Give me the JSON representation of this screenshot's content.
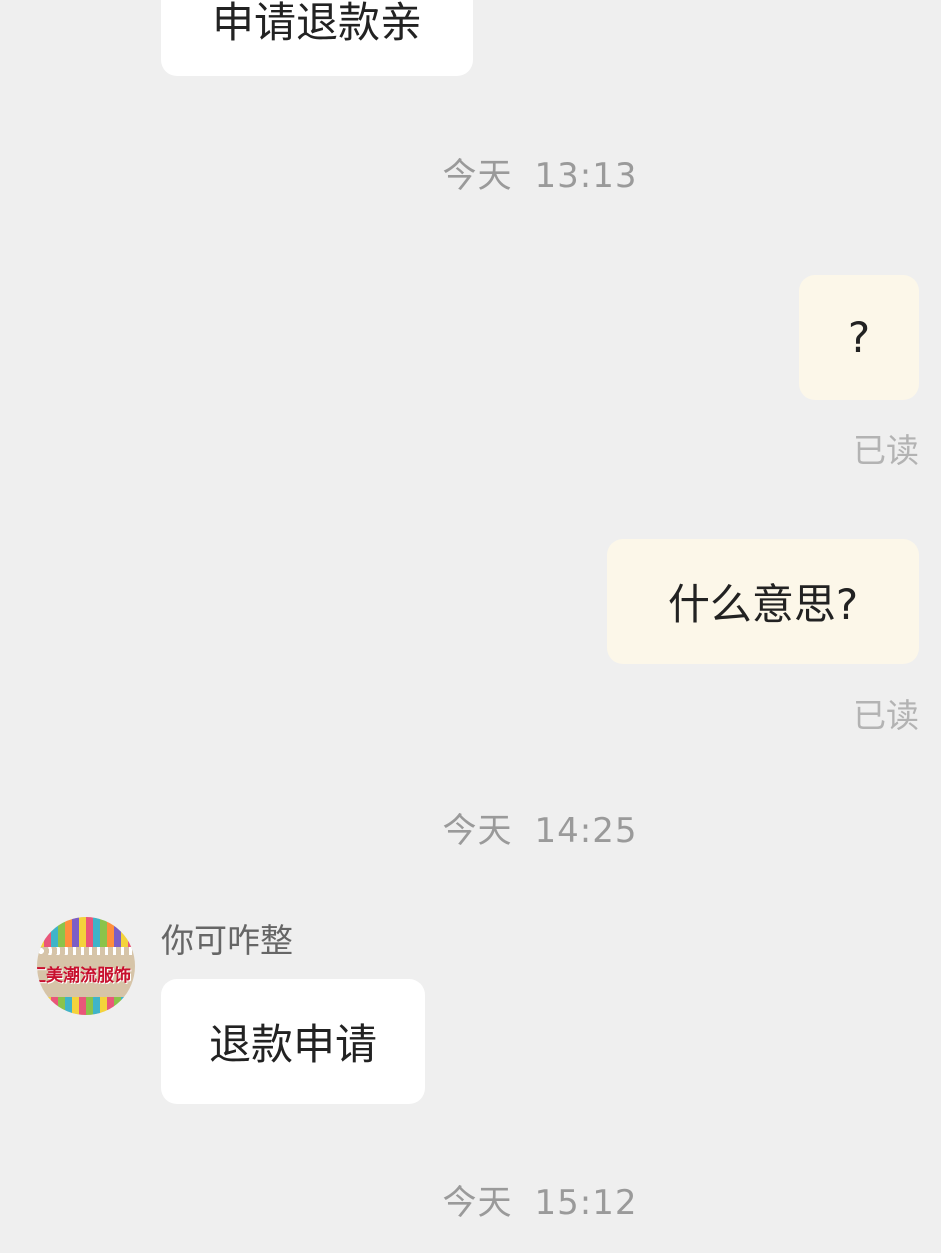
{
  "conversation": {
    "messages": [
      {
        "direction": "incoming",
        "text": "申请退款亲"
      },
      {
        "timestamp": {
          "day": "今天",
          "time": "13:13"
        }
      },
      {
        "direction": "outgoing",
        "text": "?",
        "status": "已读"
      },
      {
        "direction": "outgoing",
        "text": "什么意思?",
        "status": "已读"
      },
      {
        "timestamp": {
          "day": "今天",
          "time": "14:25"
        }
      },
      {
        "direction": "incoming",
        "sender": {
          "name": "你可咋整",
          "avatar_text": "汇美潮流服饰"
        },
        "text": "退款申请"
      },
      {
        "timestamp": {
          "day": "今天",
          "time": "15:12"
        }
      }
    ]
  },
  "colors": {
    "background": "#efefef",
    "incoming_bubble": "#ffffff",
    "outgoing_bubble": "#fcf7e9",
    "timestamp_text": "#9a9a9a",
    "read_status_text": "#b3b3b3"
  }
}
